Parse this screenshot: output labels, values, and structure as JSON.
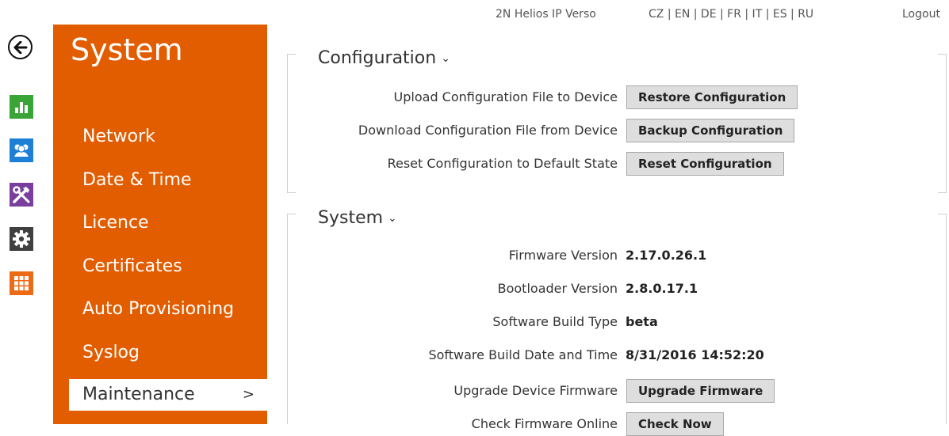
{
  "topbar": {
    "device_name": "2N Helios IP Verso",
    "languages": "CZ | EN | DE | FR | IT | ES | RU",
    "logout": "Logout"
  },
  "rail": {
    "icons": [
      "back-arrow-icon",
      "bar-chart-icon",
      "users-icon",
      "tools-icon",
      "gear-icon",
      "grid-icon"
    ],
    "colors": {
      "status": "#3aa537",
      "directory": "#1e7fd6",
      "hardware": "#7a3f9e",
      "services": "#404040",
      "system": "#ec6b15"
    }
  },
  "sidebar": {
    "title": "System",
    "accent": "#e25c00",
    "items": [
      {
        "label": "Network"
      },
      {
        "label": "Date & Time"
      },
      {
        "label": "Licence"
      },
      {
        "label": "Certificates"
      },
      {
        "label": "Auto Provisioning"
      },
      {
        "label": "Syslog"
      },
      {
        "label": "Maintenance",
        "chevron": ">"
      }
    ]
  },
  "configuration": {
    "title": "Configuration",
    "caret": "⌄",
    "rows": [
      {
        "label": "Upload Configuration File to Device",
        "button": "Restore Configuration"
      },
      {
        "label": "Download Configuration File from Device",
        "button": "Backup Configuration"
      },
      {
        "label": "Reset Configuration to Default State",
        "button": "Reset Configuration"
      }
    ]
  },
  "system": {
    "title": "System",
    "caret": "⌄",
    "rows": [
      {
        "label": "Firmware Version",
        "value": "2.17.0.26.1"
      },
      {
        "label": "Bootloader Version",
        "value": "2.8.0.17.1"
      },
      {
        "label": "Software Build Type",
        "value": "beta"
      },
      {
        "label": "Software Build Date and Time",
        "value": "8/31/2016 14:52:20"
      },
      {
        "label": "Upgrade Device Firmware",
        "button": "Upgrade Firmware"
      },
      {
        "label": "Check Firmware Online",
        "button": "Check Now"
      }
    ]
  }
}
